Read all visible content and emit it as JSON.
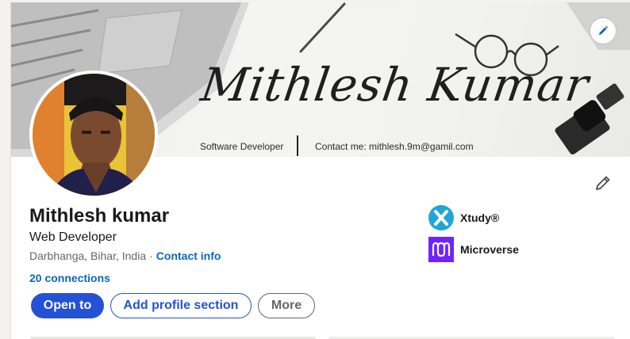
{
  "banner": {
    "signature": "Mithlesh Kumar",
    "role": "Software Developer",
    "contact": "Contact me: mithlesh.9m@gamil.com",
    "edit_icon": "pencil-icon"
  },
  "profile": {
    "name": "Mithlesh kumar",
    "headline": "Web Developer",
    "location": "Darbhanga, Bihar, India",
    "separator": "·",
    "contact_info_label": "Contact info",
    "connections_label": "20 connections",
    "edit_icon": "pencil-icon"
  },
  "actions": {
    "open_to_label": "Open to",
    "add_section_label": "Add profile section",
    "more_label": "More"
  },
  "organizations": [
    {
      "name": "Xtudy®",
      "logo_color": "#1ea6d6",
      "icon": "xtudy-logo"
    },
    {
      "name": "Microverse",
      "logo_color": "#6f23ff",
      "icon": "microverse-logo"
    }
  ],
  "colors": {
    "accent": "#0a66c2",
    "primary_button": "#2452d6"
  }
}
